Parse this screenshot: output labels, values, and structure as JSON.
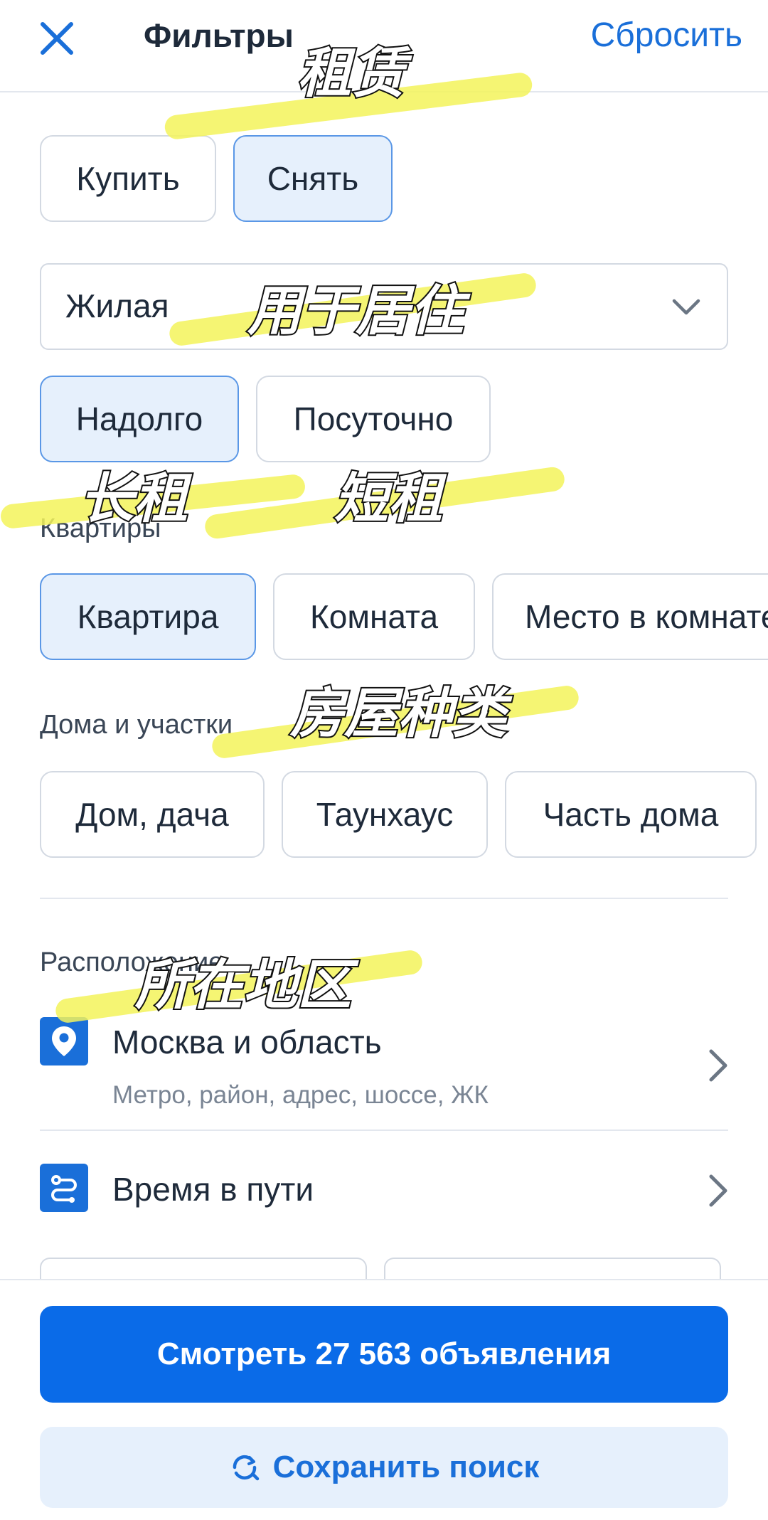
{
  "header": {
    "title": "Фильтры",
    "reset_label": "Сбросить"
  },
  "deal_type": {
    "buy_label": "Купить",
    "rent_label": "Снять"
  },
  "property_select": {
    "value": "Жилая"
  },
  "rent_term": {
    "long_label": "Надолго",
    "daily_label": "Посуточно"
  },
  "apartments": {
    "section_label": "Квартиры",
    "options": [
      "Квартира",
      "Комната",
      "Место в комнате"
    ]
  },
  "houses": {
    "section_label": "Дома и участки",
    "options": [
      "Дом, дача",
      "Таунхаус",
      "Часть дома"
    ]
  },
  "location": {
    "section_label": "Расположение",
    "region_title": "Москва и область",
    "region_subtitle": "Метро, район, адрес, шоссе, ЖК",
    "travel_time_label": "Время в пути"
  },
  "footer": {
    "show_button_label": "Смотреть 27 563 объявления",
    "save_search_label": "Сохранить поиск"
  },
  "annotations": {
    "rent": "租赁",
    "residential": "用于居住",
    "long_term": "长租",
    "short_term": "短租",
    "house_type": "房屋种类",
    "location": "所在地区"
  },
  "colors": {
    "accent": "#1a6fd9",
    "primary_button": "#0a6be8",
    "chip_active_bg": "#e6f0fc",
    "highlighter": "#f3f35a"
  },
  "icons": {
    "close": "close-icon",
    "chevron": "chevron-down-icon",
    "location": "map-pin-icon",
    "route": "route-icon",
    "save": "refresh-search-icon"
  }
}
